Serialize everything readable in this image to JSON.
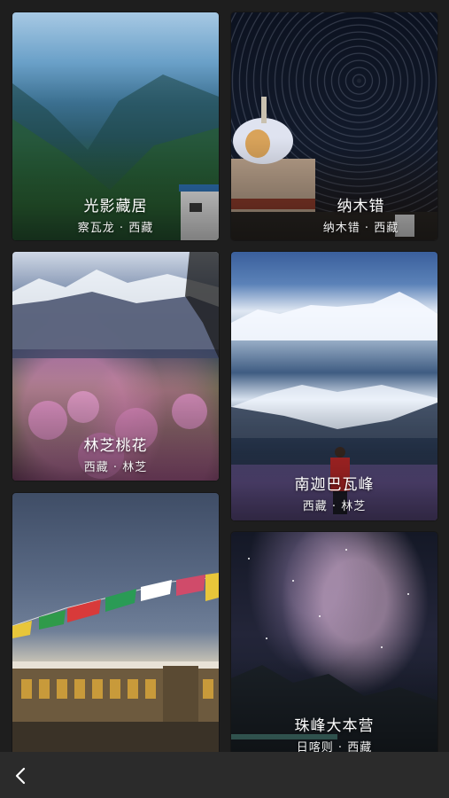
{
  "cards": [
    {
      "title": "光影藏居",
      "subtitle": "察瓦龙 · 西藏"
    },
    {
      "title": "纳木错",
      "subtitle": "纳木错 · 西藏"
    },
    {
      "title": "林芝桃花",
      "subtitle": "西藏 · 林芝"
    },
    {
      "title": "南迦巴瓦峰",
      "subtitle": "西藏 · 林芝"
    },
    {
      "title": "",
      "subtitle": ""
    },
    {
      "title": "珠峰大本营",
      "subtitle": "日喀则 · 西藏"
    }
  ],
  "nav": {
    "back_icon": "chevron-left-icon"
  }
}
